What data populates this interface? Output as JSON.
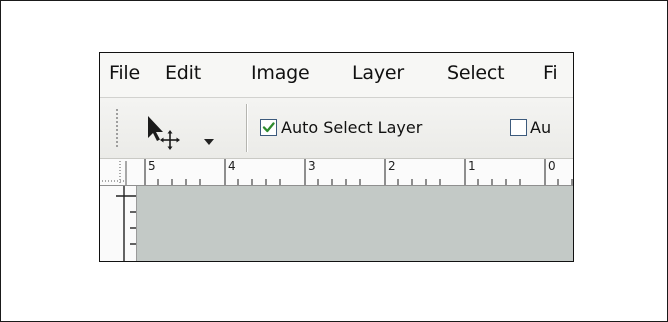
{
  "menu": {
    "items": [
      {
        "label": "File"
      },
      {
        "label": "Edit"
      },
      {
        "label": "Image"
      },
      {
        "label": "Layer"
      },
      {
        "label": "Select"
      },
      {
        "label": "Fi"
      }
    ]
  },
  "options_bar": {
    "tool_icon": "move-tool-icon",
    "dropdown_icon": "chevron-down-icon",
    "auto_select_layer": {
      "label": "Auto Select Layer",
      "checked": true
    },
    "auto_select_2": {
      "label": "Au",
      "checked": false
    }
  },
  "ruler": {
    "numbers": [
      "5",
      "4",
      "3",
      "2",
      "1",
      "0"
    ]
  },
  "colors": {
    "checkmark": "#2e8b2e",
    "canvas": "#c3c9c6"
  }
}
